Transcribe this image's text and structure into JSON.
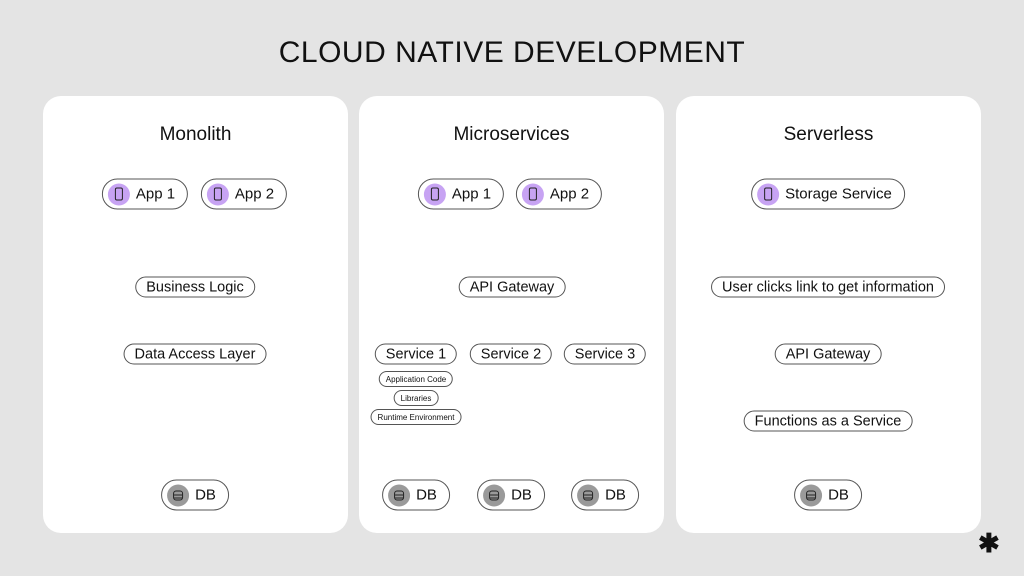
{
  "title": "CLOUD NATIVE DEVELOPMENT",
  "panels": [
    {
      "title": "Monolith",
      "nodes": [
        {
          "id": "m-app1",
          "label": "App 1",
          "icon": "phone-icon"
        },
        {
          "id": "m-app2",
          "label": "App 2",
          "icon": "phone-icon"
        },
        {
          "id": "m-bl",
          "label": "Business Logic"
        },
        {
          "id": "m-dal",
          "label": "Data Access Layer"
        },
        {
          "id": "m-db",
          "label": "DB",
          "icon": "database-icon"
        }
      ],
      "edges": [
        [
          "m-app1",
          "m-bl",
          "forward"
        ],
        [
          "m-app2",
          "m-bl",
          "forward"
        ],
        [
          "m-bl",
          "m-dal",
          "forward"
        ],
        [
          "m-dal",
          "m-db",
          "forward"
        ]
      ]
    },
    {
      "title": "Microservices",
      "nodes": [
        {
          "id": "s-app1",
          "label": "App 1",
          "icon": "phone-icon"
        },
        {
          "id": "s-app2",
          "label": "App 2",
          "icon": "phone-icon"
        },
        {
          "id": "s-gw",
          "label": "API Gateway"
        },
        {
          "id": "s-s1",
          "label": "Service 1"
        },
        {
          "id": "s-s2",
          "label": "Service 2"
        },
        {
          "id": "s-s3",
          "label": "Service 3"
        },
        {
          "id": "s-ac",
          "label": "Application Code"
        },
        {
          "id": "s-lib",
          "label": "Libraries"
        },
        {
          "id": "s-rt",
          "label": "Runtime Environment"
        },
        {
          "id": "s-db1",
          "label": "DB",
          "icon": "database-icon"
        },
        {
          "id": "s-db2",
          "label": "DB",
          "icon": "database-icon"
        },
        {
          "id": "s-db3",
          "label": "DB",
          "icon": "database-icon"
        }
      ],
      "edges": [
        [
          "s-app1",
          "s-gw",
          "forward"
        ],
        [
          "s-app2",
          "s-gw",
          "forward"
        ],
        [
          "s-gw",
          "s-s1",
          "forward"
        ],
        [
          "s-gw",
          "s-s2",
          "forward"
        ],
        [
          "s-gw",
          "s-s3",
          "forward"
        ],
        [
          "s-s1",
          "s-ac",
          "none"
        ],
        [
          "s-ac",
          "s-lib",
          "none"
        ],
        [
          "s-lib",
          "s-rt",
          "none"
        ],
        [
          "s-rt",
          "s-db1",
          "forward"
        ],
        [
          "s-s2",
          "s-db2",
          "forward"
        ],
        [
          "s-s3",
          "s-db3",
          "forward"
        ]
      ]
    },
    {
      "title": "Serverless",
      "nodes": [
        {
          "id": "v-ss",
          "label": "Storage Service",
          "icon": "phone-icon"
        },
        {
          "id": "v-uc",
          "label": "User clicks link to get information"
        },
        {
          "id": "v-gw",
          "label": "API Gateway"
        },
        {
          "id": "v-faas",
          "label": "Functions as a Service"
        },
        {
          "id": "v-db",
          "label": "DB",
          "icon": "database-icon"
        }
      ],
      "edges": [
        [
          "v-ss",
          "v-uc",
          "forward"
        ],
        [
          "v-uc",
          "v-gw",
          "both"
        ],
        [
          "v-gw",
          "v-faas",
          "both"
        ],
        [
          "v-faas",
          "v-db",
          "forward"
        ]
      ]
    }
  ],
  "logo": "✱"
}
